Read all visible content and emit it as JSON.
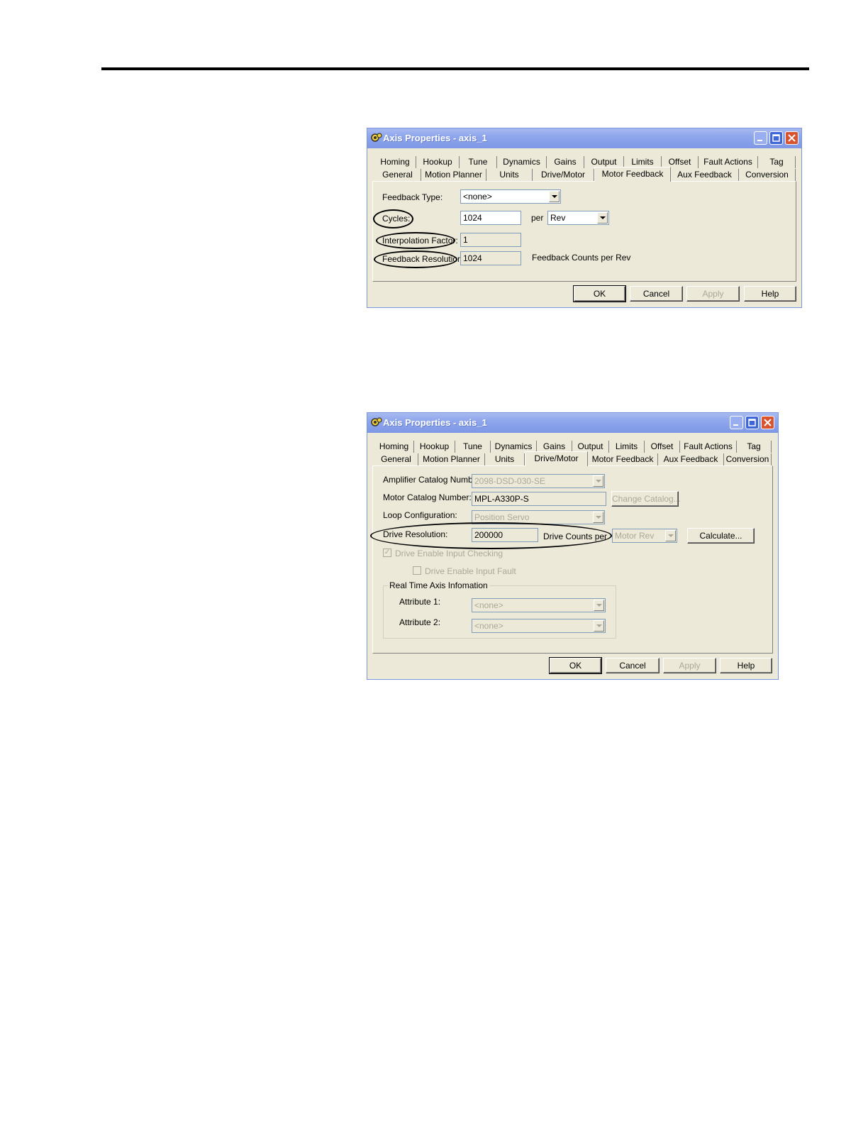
{
  "dialog1": {
    "title": "Axis Properties - axis_1",
    "tabs_row1": [
      "Homing",
      "Hookup",
      "Tune",
      "Dynamics",
      "Gains",
      "Output",
      "Limits",
      "Offset",
      "Fault Actions",
      "Tag"
    ],
    "tabs_row2": [
      "General",
      "Motion Planner",
      "Units",
      "Drive/Motor",
      "Motor Feedback",
      "Aux Feedback",
      "Conversion"
    ],
    "active_tab": "Motor Feedback",
    "feedback_type_label": "Feedback Type:",
    "feedback_type_value": "<none>",
    "cycles_label": "Cycles:",
    "cycles_value": "1024",
    "per_label": "per",
    "per_unit_value": "Rev",
    "interpolation_label": "Interpolation Factor:",
    "interpolation_value": "1",
    "feedback_resolution_label": "Feedback Resolution:",
    "feedback_resolution_value": "1024",
    "feedback_units_text": "Feedback Counts per Rev",
    "buttons": {
      "ok": "OK",
      "cancel": "Cancel",
      "apply": "Apply",
      "help": "Help"
    }
  },
  "dialog2": {
    "title": "Axis Properties - axis_1",
    "tabs_row1": [
      "Homing",
      "Hookup",
      "Tune",
      "Dynamics",
      "Gains",
      "Output",
      "Limits",
      "Offset",
      "Fault Actions",
      "Tag"
    ],
    "tabs_row2": [
      "General",
      "Motion Planner",
      "Units",
      "Drive/Motor",
      "Motor Feedback",
      "Aux Feedback",
      "Conversion"
    ],
    "active_tab": "Drive/Motor",
    "amplifier_label": "Amplifier Catalog Number:",
    "amplifier_value": "2098-DSD-030-SE",
    "motor_label": "Motor Catalog Number:",
    "motor_value": "MPL-A330P-S",
    "change_catalog": "Change Catalog...",
    "loop_label": "Loop Configuration:",
    "loop_value": "Position Servo",
    "drive_resolution_label": "Drive Resolution:",
    "drive_resolution_value": "200000",
    "drive_counts_label": "Drive Counts per",
    "motor_rev_value": "Motor Rev",
    "calculate": "Calculate...",
    "drive_enable_checking": "Drive Enable Input Checking",
    "drive_enable_fault": "Drive Enable Input Fault",
    "realtime_group": "Real Time Axis Infomation",
    "attribute1_label": "Attribute 1:",
    "attribute1_value": "<none>",
    "attribute2_label": "Attribute 2:",
    "attribute2_value": "<none>",
    "buttons": {
      "ok": "OK",
      "cancel": "Cancel",
      "apply": "Apply",
      "help": "Help"
    }
  }
}
